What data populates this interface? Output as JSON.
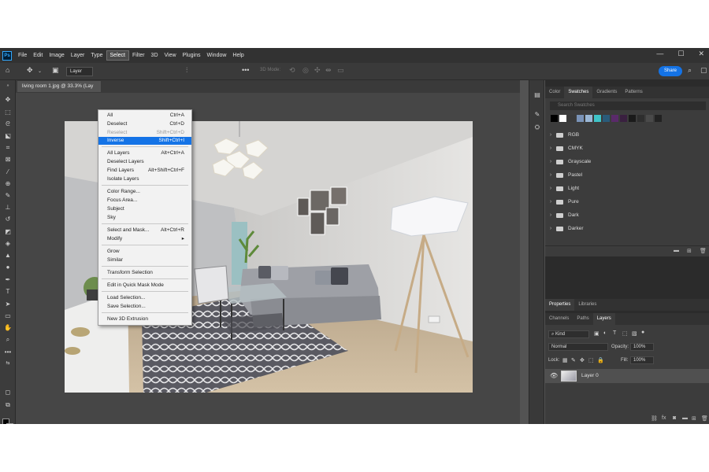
{
  "menubar": {
    "items": [
      "File",
      "Edit",
      "Image",
      "Layer",
      "Type",
      "Select",
      "Filter",
      "3D",
      "View",
      "Plugins",
      "Window",
      "Help"
    ],
    "logo": "Ps",
    "window_controls": [
      "—",
      "☐",
      "✕"
    ]
  },
  "options": {
    "layer_select": "Layer",
    "mode_3d": "3D Mode:",
    "share": "Share"
  },
  "document": {
    "tab_title": "living room 1.jpg @ 33.3% (Lay"
  },
  "select_menu": {
    "groups": [
      [
        {
          "label": "All",
          "shortcut": "Ctrl+A",
          "state": "normal"
        },
        {
          "label": "Deselect",
          "shortcut": "Ctrl+D",
          "state": "normal"
        },
        {
          "label": "Reselect",
          "shortcut": "Shift+Ctrl+D",
          "state": "disabled"
        },
        {
          "label": "Inverse",
          "shortcut": "Shift+Ctrl+I",
          "state": "highlighted"
        }
      ],
      [
        {
          "label": "All Layers",
          "shortcut": "Alt+Ctrl+A",
          "state": "normal"
        },
        {
          "label": "Deselect Layers",
          "shortcut": "",
          "state": "normal"
        },
        {
          "label": "Find Layers",
          "shortcut": "Alt+Shift+Ctrl+F",
          "state": "normal"
        },
        {
          "label": "Isolate Layers",
          "shortcut": "",
          "state": "normal"
        }
      ],
      [
        {
          "label": "Color Range...",
          "shortcut": "",
          "state": "normal"
        },
        {
          "label": "Focus Area...",
          "shortcut": "",
          "state": "normal"
        },
        {
          "label": "Subject",
          "shortcut": "",
          "state": "normal"
        },
        {
          "label": "Sky",
          "shortcut": "",
          "state": "normal"
        }
      ],
      [
        {
          "label": "Select and Mask...",
          "shortcut": "Alt+Ctrl+R",
          "state": "normal"
        },
        {
          "label": "Modify",
          "shortcut": "▸",
          "state": "normal"
        }
      ],
      [
        {
          "label": "Grow",
          "shortcut": "",
          "state": "normal"
        },
        {
          "label": "Similar",
          "shortcut": "",
          "state": "normal"
        }
      ],
      [
        {
          "label": "Transform Selection",
          "shortcut": "",
          "state": "normal"
        }
      ],
      [
        {
          "label": "Edit in Quick Mask Mode",
          "shortcut": "",
          "state": "normal"
        }
      ],
      [
        {
          "label": "Load Selection...",
          "shortcut": "",
          "state": "normal"
        },
        {
          "label": "Save Selection...",
          "shortcut": "",
          "state": "normal"
        }
      ],
      [
        {
          "label": "New 3D Extrusion",
          "shortcut": "",
          "state": "normal"
        }
      ]
    ]
  },
  "swatches_panel": {
    "tabs": [
      "Color",
      "Swatches",
      "Gradients",
      "Patterns"
    ],
    "active_tab": "Swatches",
    "search_placeholder": "Search Swatches",
    "recent_colors": [
      "#000000",
      "#ffffff",
      "#3a3a3a",
      "#7a93b8",
      "#9ab7d6",
      "#3fc4c8",
      "#2a5b7a",
      "#5a2a6a",
      "#3a2040",
      "#1a1a1a",
      "#2e2e2e",
      "#4a4a4a",
      "#222222"
    ],
    "folders": [
      "RGB",
      "CMYK",
      "Grayscale",
      "Pastel",
      "Light",
      "Pure",
      "Dark",
      "Darker"
    ]
  },
  "properties_tabs": {
    "tabs": [
      "Properties",
      "Libraries"
    ],
    "active_tab": "Properties"
  },
  "layers_panel": {
    "tabs": [
      "Channels",
      "Paths",
      "Layers"
    ],
    "active_tab": "Layers",
    "filter_kind": "Kind",
    "blend_mode": "Normal",
    "opacity_label": "Opacity:",
    "opacity_value": "100%",
    "lock_label": "Lock:",
    "fill_label": "Fill:",
    "fill_value": "100%",
    "layers": [
      {
        "name": "Layer 0",
        "visible": true
      }
    ]
  }
}
